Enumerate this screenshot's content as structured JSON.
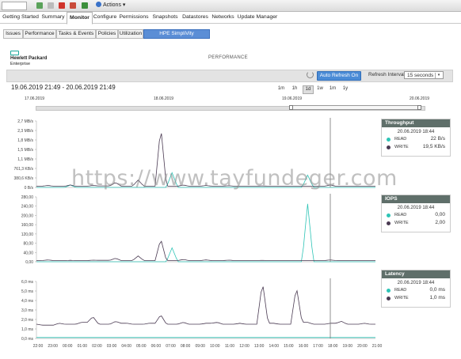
{
  "toolbar": {
    "actions_label": "Actions"
  },
  "tabs": [
    {
      "label": "Getting Started"
    },
    {
      "label": "Summary"
    },
    {
      "label": "Monitor"
    },
    {
      "label": "Configure"
    },
    {
      "label": "Permissions"
    },
    {
      "label": "Snapshots"
    },
    {
      "label": "Datastores"
    },
    {
      "label": "Networks"
    },
    {
      "label": "Update Manager"
    }
  ],
  "subtabs": [
    {
      "label": "Issues"
    },
    {
      "label": "Performance"
    },
    {
      "label": "Tasks & Events"
    },
    {
      "label": "Policies"
    },
    {
      "label": "Utilization"
    },
    {
      "label": "HPE SimpliVity Performance"
    }
  ],
  "logo": {
    "line1": "Hewlett Packard",
    "line2": "Enterprise"
  },
  "page_title": "PERFORMANCE",
  "controls": {
    "auto_refresh": "Auto Refresh On",
    "refresh_interval_label": "Refresh Interval",
    "refresh_interval_value": "15 seconds"
  },
  "date_range": "19.06.2019 21:49 - 20.06.2019 21:49",
  "zoom": [
    "1m",
    "1h",
    "1d",
    "1w",
    "1m",
    "1y"
  ],
  "navigator_dates": [
    "17.06.2019",
    "18.06.2019",
    "19.06.2019",
    "20.06.2019"
  ],
  "panels": {
    "throughput": {
      "title": "Throughput",
      "timestamp": "20.06.2019 18:44",
      "read_label": "READ",
      "read_value": "22 B/s",
      "write_label": "WRITE",
      "write_value": "19,5 KB/s"
    },
    "iops": {
      "title": "IOPS",
      "timestamp": "20.06.2019 18:44",
      "read_label": "READ",
      "read_value": "0,00",
      "write_label": "WRITE",
      "write_value": "2,00"
    },
    "latency": {
      "title": "Latency",
      "timestamp": "20.06.2019 18:44",
      "read_label": "READ",
      "read_value": "0,0 ms",
      "write_label": "WRITE",
      "write_value": "1,0 ms"
    }
  },
  "watermark": "https://www.tayfundeger.com",
  "colors": {
    "read": "#2ec4b6",
    "write": "#4a3a52",
    "accent": "#4a8bd6"
  },
  "chart_data": [
    {
      "type": "line",
      "ylabel": "Throughput",
      "yticks": [
        "0 B/s",
        "380,6 KB/s",
        "761,3 KB/s",
        "1,1 MB/s",
        "1,5 MB/s",
        "1,8 MB/s",
        "2,3 MB/s",
        "2,7 MB/s"
      ],
      "series": [
        {
          "name": "READ",
          "values": [
            0,
            0,
            0,
            0.1,
            0,
            0,
            0,
            0,
            0,
            0,
            0,
            0,
            0.6,
            0,
            0,
            0,
            0,
            0,
            0,
            0,
            0,
            0,
            0,
            0,
            0.5,
            0,
            0,
            0,
            0,
            0,
            0
          ]
        },
        {
          "name": "WRITE",
          "values": [
            0.05,
            0.08,
            0.05,
            0.1,
            0.05,
            0.08,
            0.06,
            0.2,
            0.05,
            0.3,
            0.05,
            2.5,
            0.05,
            0.1,
            0.05,
            0.08,
            0.05,
            0.07,
            0.05,
            0.05,
            0.06,
            0.05,
            0.05,
            0.05,
            0.05,
            0.05,
            0.1,
            0.05,
            0.05,
            0.05,
            0.05
          ]
        }
      ]
    },
    {
      "type": "line",
      "ylabel": "IOPS",
      "yticks": [
        "0,00",
        "40,00",
        "80,00",
        "120,00",
        "160,00",
        "200,00",
        "240,00",
        "280,00"
      ],
      "series": [
        {
          "name": "READ",
          "values": [
            0,
            0,
            0,
            0,
            0,
            0,
            0,
            0,
            0,
            0,
            0,
            0,
            60,
            0,
            0,
            0,
            0,
            0,
            0,
            0,
            0,
            0,
            0,
            0,
            250,
            0,
            0,
            0,
            0,
            0,
            0
          ]
        },
        {
          "name": "WRITE",
          "values": [
            5,
            8,
            5,
            6,
            5,
            7,
            6,
            15,
            5,
            25,
            5,
            100,
            5,
            10,
            5,
            8,
            5,
            7,
            5,
            5,
            6,
            5,
            5,
            5,
            5,
            5,
            8,
            5,
            5,
            5,
            5
          ]
        }
      ]
    },
    {
      "type": "line",
      "ylabel": "Latency",
      "yticks": [
        "0,0 ms",
        "1,0 ms",
        "2,0 ms",
        "3,0 ms",
        "4,0 ms",
        "5,0 ms",
        "6,0 ms"
      ],
      "series": [
        {
          "name": "READ",
          "values": [
            0.1,
            0.1,
            0.1,
            0.1,
            0.1,
            0.1,
            0.1,
            0.1,
            0.1,
            0.1,
            0.1,
            0.1,
            0.1,
            0.1,
            0.1,
            0.1,
            0.1,
            0.1,
            0.1,
            0.1,
            0.1,
            0.1,
            0.1,
            0.1,
            0.1,
            0.1,
            0.1,
            0.1,
            0.1,
            0.1,
            0.1
          ]
        },
        {
          "name": "WRITE",
          "values": [
            1.5,
            1.4,
            1.6,
            1.5,
            1.7,
            2.3,
            1.5,
            1.8,
            1.6,
            1.5,
            1.6,
            2.5,
            1.5,
            1.7,
            1.5,
            1.6,
            1.7,
            1.5,
            1.6,
            1.5,
            6.0,
            1.6,
            1.5,
            5.5,
            1.7,
            1.5,
            1.6,
            1.8,
            1.5,
            1.6,
            1.5
          ]
        }
      ]
    }
  ],
  "xticks": [
    "22:00",
    "23:00",
    "00:00",
    "01:00",
    "02:00",
    "03:00",
    "04:00",
    "05:00",
    "06:00",
    "07:00",
    "08:00",
    "09:00",
    "10:00",
    "11:00",
    "12:00",
    "13:00",
    "14:00",
    "15:00",
    "16:00",
    "17:00",
    "18:00",
    "19:00",
    "20:00",
    "21:00"
  ]
}
